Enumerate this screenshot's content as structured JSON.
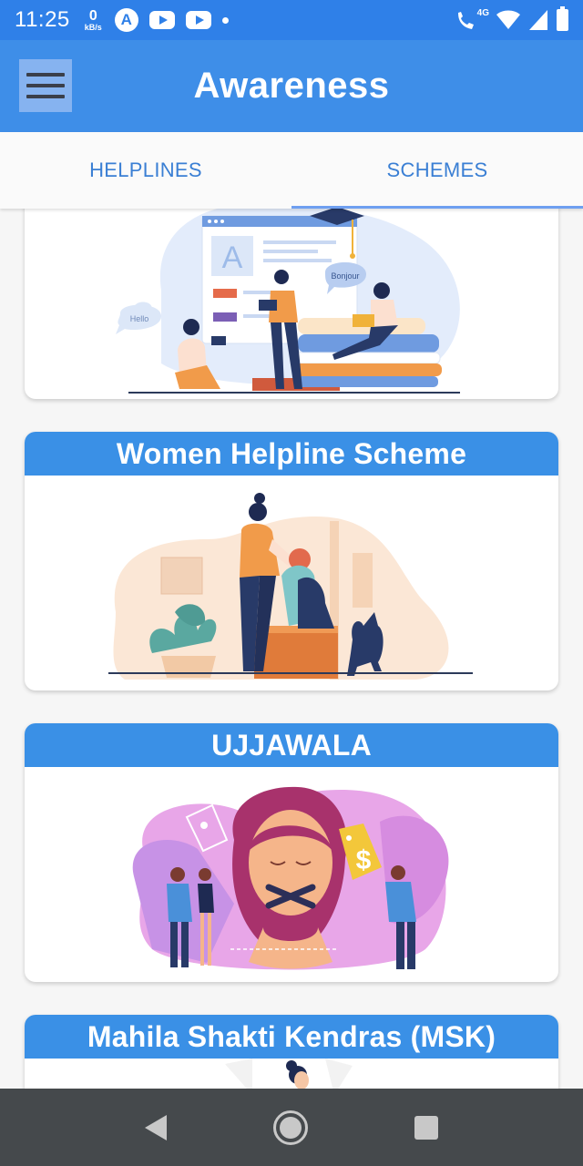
{
  "status_bar": {
    "time": "11:25",
    "speed_value": "0",
    "speed_unit": "kB/s",
    "app_icon_letter": "A",
    "network_type": "4G",
    "icons": [
      "speed-indicator-icon",
      "notification-a-icon",
      "youtube-icon",
      "youtube-icon",
      "dot-icon",
      "call-wifi-icon",
      "wifi-icon",
      "signal-icon",
      "battery-icon"
    ]
  },
  "app_bar": {
    "title": "Awareness",
    "menu_icon": "hamburger-menu-icon"
  },
  "tabs": [
    {
      "label": "HELPLINES",
      "active": false
    },
    {
      "label": "SCHEMES",
      "active": true
    }
  ],
  "cards": [
    {
      "title": "",
      "illustration": "education-illustration"
    },
    {
      "title": "Women Helpline Scheme",
      "illustration": "comfort-support-illustration"
    },
    {
      "title": "UJJAWALA",
      "illustration": "trafficking-awareness-illustration"
    },
    {
      "title": "Mahila Shakti Kendras (MSK)",
      "illustration": "empowerment-illustration"
    }
  ],
  "illustration_text": {
    "letter_a": "A",
    "hello": "Hello",
    "bonjour": "Bonjour",
    "dollar": "$"
  },
  "nav_bar": {
    "icons": [
      "back-icon",
      "home-icon",
      "recents-icon"
    ]
  },
  "colors": {
    "primary": "#3e8ee8",
    "status_bar": "#2f80e8",
    "tab_text": "#3a7fd4",
    "tab_indicator": "#6e9ff0",
    "card_header": "#3a90e6",
    "nav_bar": "#45494c"
  }
}
